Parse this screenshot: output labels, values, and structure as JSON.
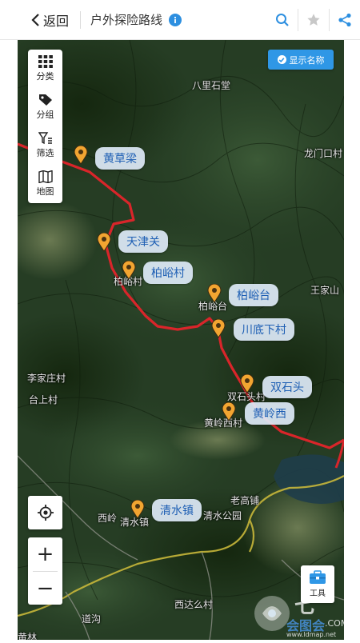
{
  "header": {
    "back_label": "返回",
    "title": "户外探险路线"
  },
  "sidebar": {
    "items": [
      {
        "label": "分类",
        "icon": "grid-icon"
      },
      {
        "label": "分组",
        "icon": "tag-icon"
      },
      {
        "label": "筛选",
        "icon": "filter-icon"
      },
      {
        "label": "地图",
        "icon": "map-icon"
      }
    ]
  },
  "show_names_label": "显示名称",
  "tools_label": "工具",
  "zoom": {
    "in": "+",
    "out": "−"
  },
  "markers": [
    "黄草梁",
    "天津关",
    "柏峪村",
    "柏峪台",
    "川底下村",
    "双石头",
    "黄岭西",
    "清水镇"
  ],
  "places": [
    "八里石堂",
    "龙门口村",
    "王家山",
    "李家庄村",
    "台上村",
    "柏峪村",
    "柏峪台",
    "双石头村",
    "黄岭西村",
    "老高铺",
    "清水公园",
    "西岭",
    "清水镇",
    "西达么村",
    "道沟",
    "黄林"
  ],
  "watermark": {
    "text1": "七",
    "text2": "会图会",
    "text3": ".COM",
    "text4": "www.ldmap.net"
  },
  "colors": {
    "accent": "#2f97e6",
    "route": "#d9252a",
    "label_text": "#1e5fb4",
    "road": "#c8b73a"
  }
}
